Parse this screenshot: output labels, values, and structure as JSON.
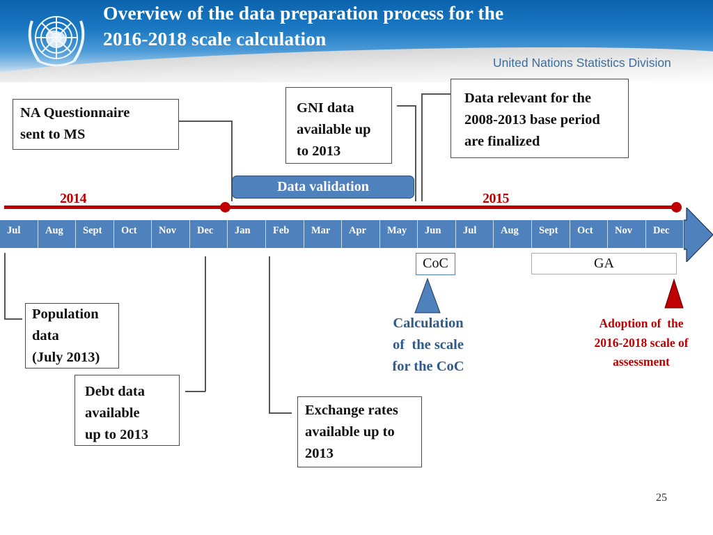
{
  "header": {
    "title_line1": "Overview of the data preparation process for the",
    "title_line2": "2016-2018 scale calculation",
    "division": "United Nations Statistics Division",
    "logo_icon": "un-emblem-icon"
  },
  "colors": {
    "timeline_red": "#c00000",
    "month_blue": "#4f81bd",
    "note_blue": "#2f5a8c",
    "header_blue": "#0d63ad"
  },
  "timeline": {
    "years": [
      "2014",
      "2015"
    ],
    "months": [
      "Jul",
      "Aug",
      "Sept",
      "Oct",
      "Nov",
      "Dec",
      "Jan",
      "Feb",
      "Mar",
      "Apr",
      "May",
      "Jun",
      "Jul",
      "Aug",
      "Sept",
      "Oct",
      "Nov",
      "Dec"
    ],
    "bar_label": "Data validation"
  },
  "boxes": {
    "na_questionnaire": [
      "NA Questionnaire",
      "sent to MS"
    ],
    "gni": [
      "GNI data",
      "available up",
      "to 2013"
    ],
    "base_period": [
      "Data relevant for the",
      "2008-2013 base period",
      "are finalized"
    ],
    "population": [
      "Population",
      "data",
      "(July 2013)"
    ],
    "debt": [
      "Debt data",
      "available",
      "up to 2013"
    ],
    "exchange": [
      "Exchange rates",
      "available up to",
      "2013"
    ]
  },
  "markers": {
    "coc_label": "CoC",
    "ga_label": "GA",
    "coc_note": [
      "Calculation",
      "of  the scale",
      "for the CoC"
    ],
    "ga_note": [
      "Adoption of  the",
      "2016-2018 scale of",
      "assessment"
    ]
  },
  "page_number": "25"
}
